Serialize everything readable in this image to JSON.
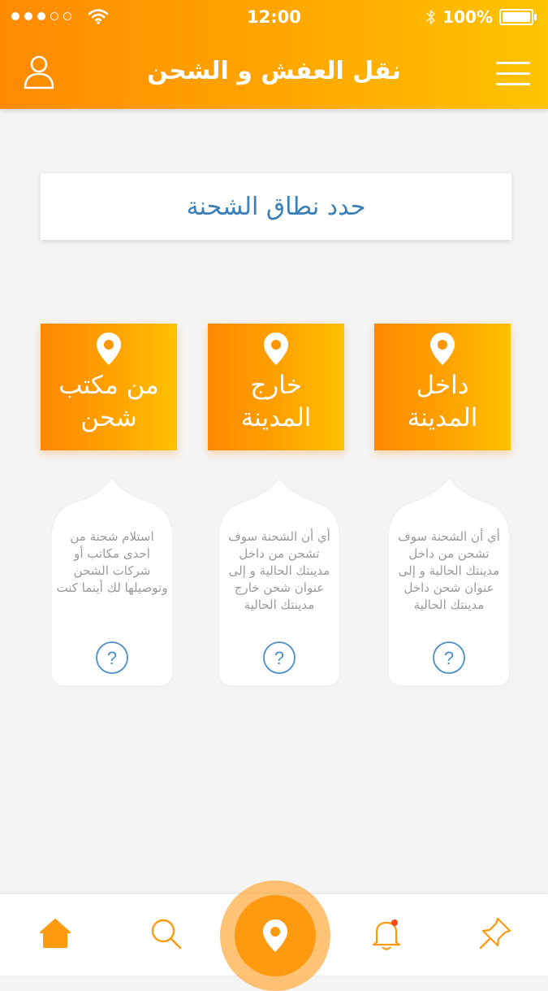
{
  "status_bar": {
    "time": "12:00",
    "battery": "100%"
  },
  "header": {
    "title": "نقل العفش و الشحن"
  },
  "scope_select": {
    "label": "حدد نطاق الشحنة"
  },
  "options": [
    {
      "title": "داخل المدينة",
      "description": "أي أن الشحنة سوف تشحن من داخل مدينتك الحالية و إلى عنوان شحن داخل مدينتك الحالية"
    },
    {
      "title": "خارج المدينة",
      "description": "أي أن الشحنة سوف تشحن من داخل مدينتك الحالية و إلى عنوان شحن خارج مدينتك الحالية"
    },
    {
      "title": "من مكتب شحن",
      "description": "استلام شحنة من احدى مكاتب أو شركات الشحن وتوصيلها لك أينما كنت"
    }
  ],
  "help_symbol": "?",
  "tabbar": {
    "items": [
      "home-icon",
      "search-icon",
      "location-pin-icon",
      "notification-bell-icon",
      "pushpin-icon"
    ]
  },
  "colors": {
    "accent": "#ff9a10",
    "accent_light": "#ffc200",
    "link_blue": "#3a7fb5",
    "help_blue": "#4a8fc7"
  }
}
